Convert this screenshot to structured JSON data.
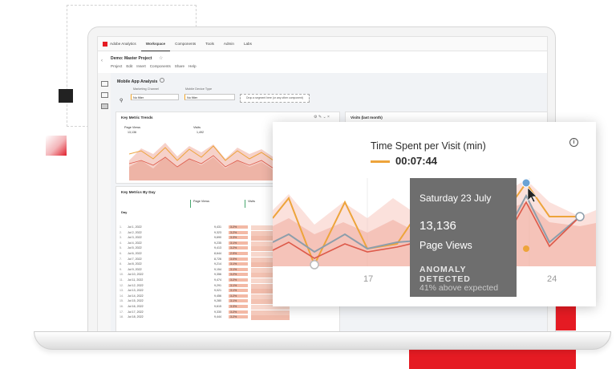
{
  "app": {
    "brand": "Adobe Analytics",
    "tabs": [
      "Workspace",
      "Components",
      "Tools",
      "Admin",
      "Labs"
    ],
    "active_tab": "Workspace"
  },
  "project": {
    "name": "Demo: Master Project",
    "menu": [
      "Project",
      "Edit",
      "Insert",
      "Components",
      "Share",
      "Help"
    ]
  },
  "panel": {
    "title": "Mobile App Analysis",
    "filters": [
      {
        "label": "Marketing Channel",
        "value": "No filter"
      },
      {
        "label": "Mobile Device Type",
        "value": "No filter"
      }
    ],
    "dropzone": "Drop a segment here (or any other component)"
  },
  "key_metric_trends": {
    "title": "Key Metric Trends",
    "metrics": [
      {
        "name": "Page Views",
        "value": "13,136"
      },
      {
        "name": "Visits",
        "value": "1,492"
      }
    ]
  },
  "visits_card": {
    "title": "Visits (last month)"
  },
  "key_metrics_by_day": {
    "title": "Key Metrics By Day",
    "columns": [
      "Page Views",
      "Visits"
    ],
    "dim_header": "Day",
    "rows": [
      {
        "day": "Jul 1, 2022",
        "pv": "9,431",
        "pct": "3.2%"
      },
      {
        "day": "Jul 2, 2022",
        "pv": "9,323",
        "pct": "3.2%"
      },
      {
        "day": "Jul 3, 2022",
        "pv": "9,690",
        "pct": "3.3%"
      },
      {
        "day": "Jul 4, 2022",
        "pv": "9,235",
        "pct": "3.1%"
      },
      {
        "day": "Jul 5, 2022",
        "pv": "9,413",
        "pct": "3.2%"
      },
      {
        "day": "Jul 6, 2022",
        "pv": "8,644",
        "pct": "2.9%"
      },
      {
        "day": "Jul 7, 2022",
        "pv": "8,726",
        "pct": "3.0%"
      },
      {
        "day": "Jul 8, 2022",
        "pv": "9,214",
        "pct": "3.1%"
      },
      {
        "day": "Jul 9, 2022",
        "pv": "9,154",
        "pct": "3.1%"
      },
      {
        "day": "Jul 10, 2022",
        "pv": "9,356",
        "pct": "3.2%"
      },
      {
        "day": "Jul 11, 2022",
        "pv": "9,474",
        "pct": "3.2%"
      },
      {
        "day": "Jul 12, 2022",
        "pv": "9,291",
        "pct": "3.1%"
      },
      {
        "day": "Jul 13, 2022",
        "pv": "9,021",
        "pct": "3.1%"
      },
      {
        "day": "Jul 14, 2022",
        "pv": "9,456",
        "pct": "3.2%"
      },
      {
        "day": "Jul 15, 2022",
        "pv": "9,280",
        "pct": "3.1%"
      },
      {
        "day": "Jul 16, 2022",
        "pv": "9,615",
        "pct": "3.3%"
      },
      {
        "day": "Jul 17, 2022",
        "pv": "9,330",
        "pct": "3.2%"
      },
      {
        "day": "Jul 18, 2022",
        "pv": "9,444",
        "pct": "3.2%"
      }
    ]
  },
  "popup": {
    "title": "Time Spent per Visit (min)",
    "value": "00:07:44",
    "x_labels": [
      "17",
      "24"
    ],
    "series_colors": {
      "time_spent": "#eda43b",
      "page_views": "#dd5a4a",
      "visits": "#8d9eab"
    },
    "info_icon": "info-icon"
  },
  "tooltip": {
    "date": "Saturday 23 July",
    "value": "13,136",
    "metric": "Page Views",
    "status": "ANOMALY DETECTED",
    "detail": "41% above expected"
  }
}
